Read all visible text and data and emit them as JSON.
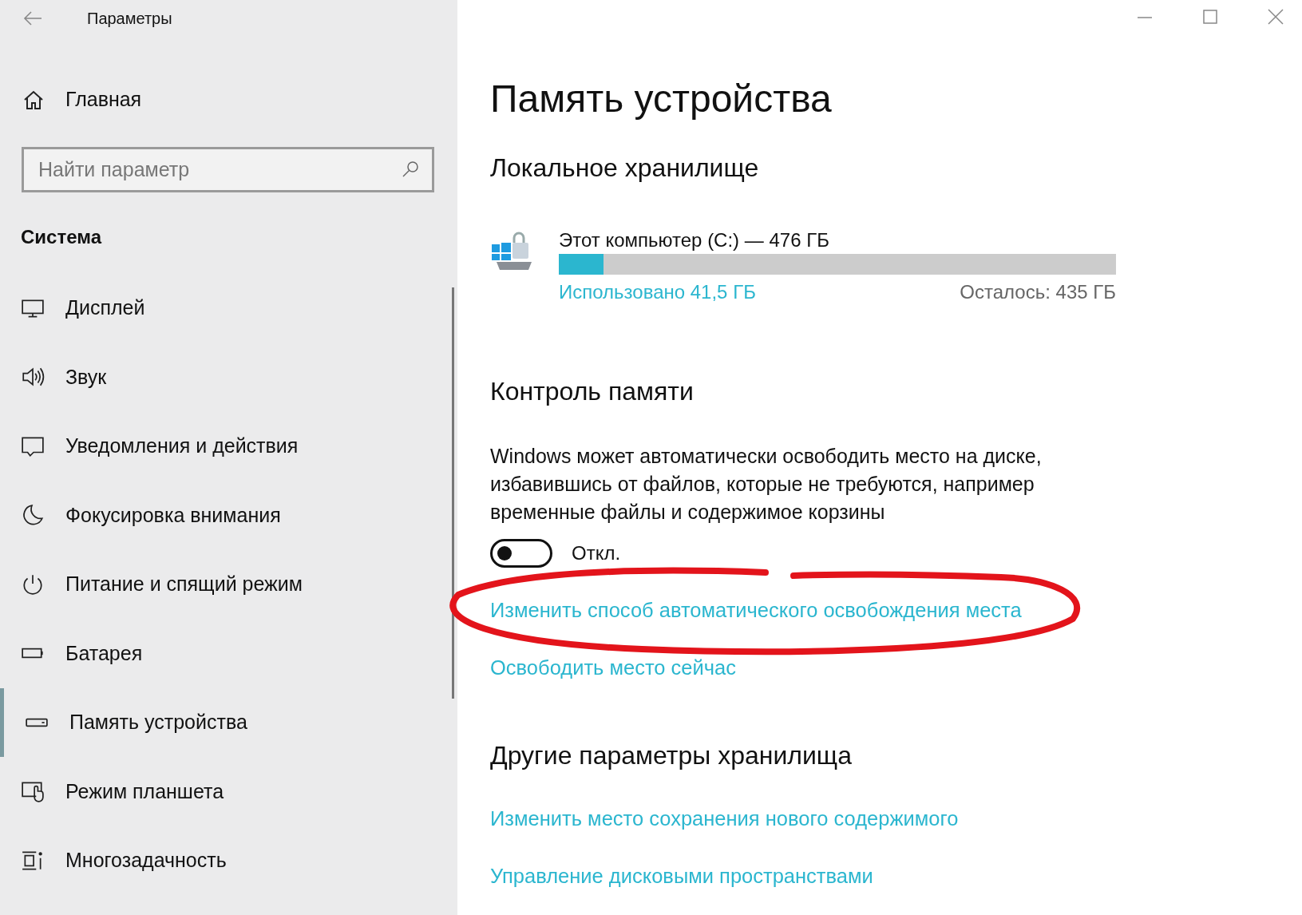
{
  "window": {
    "title": "Параметры"
  },
  "sidebar": {
    "home": "Главная",
    "search": {
      "placeholder": "Найти параметр"
    },
    "section": "Система",
    "items": [
      {
        "label": "Дисплей",
        "selected": false
      },
      {
        "label": "Звук",
        "selected": false
      },
      {
        "label": "Уведомления и действия",
        "selected": false
      },
      {
        "label": "Фокусировка внимания",
        "selected": false
      },
      {
        "label": "Питание и спящий режим",
        "selected": false
      },
      {
        "label": "Батарея",
        "selected": false
      },
      {
        "label": "Память устройства",
        "selected": true
      },
      {
        "label": "Режим планшета",
        "selected": false
      },
      {
        "label": "Многозадачность",
        "selected": false
      }
    ]
  },
  "main": {
    "title": "Память устройства",
    "local_storage": {
      "heading": "Локальное хранилище",
      "drive": {
        "name": "Этот компьютер (C:) — 476 ГБ",
        "level": 0.08,
        "used": "Использовано 41,5 ГБ",
        "free": "Осталось: 435 ГБ"
      }
    },
    "storage_sense": {
      "heading": "Контроль памяти",
      "description": "Windows может автоматически освободить место на диске, избавившись от файлов, которые не требуются, например временные файлы и содержимое корзины",
      "toggle": {
        "on": false,
        "label": "Откл."
      },
      "links": [
        {
          "label": "Изменить способ автоматического освобождения места",
          "circled": true
        },
        {
          "label": "Освободить место сейчас",
          "circled": false
        }
      ]
    },
    "more": {
      "heading": "Другие параметры хранилища",
      "links": [
        "Изменить место сохранения нового содержимого",
        "Управление дисковыми пространствами"
      ]
    }
  }
}
